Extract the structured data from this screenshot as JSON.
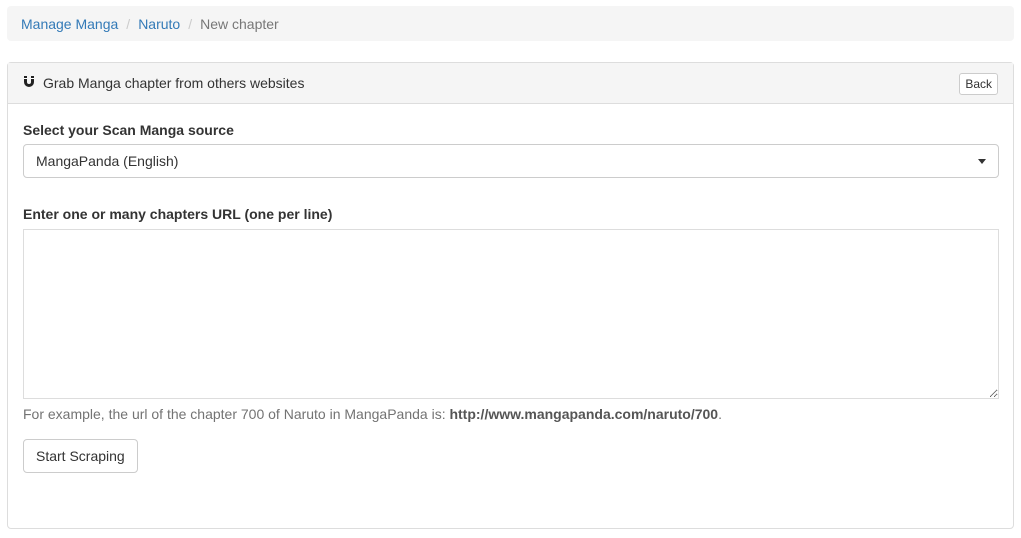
{
  "breadcrumb": {
    "items": [
      "Manage Manga",
      "Naruto"
    ],
    "active": "New chapter"
  },
  "panel": {
    "title": "Grab Manga chapter from others websites",
    "icon": "magnet-icon",
    "back_label": "Back"
  },
  "form": {
    "source_label": "Select your Scan Manga source",
    "source_value": "MangaPanda (English)",
    "urls_label": "Enter one or many chapters URL (one per line)",
    "urls_value": "",
    "help_prefix": "For example, the url of the chapter 700 of Naruto in MangaPanda is: ",
    "help_url": "http://www.mangapanda.com/naruto/700",
    "help_suffix": ".",
    "submit_label": "Start Scraping"
  }
}
